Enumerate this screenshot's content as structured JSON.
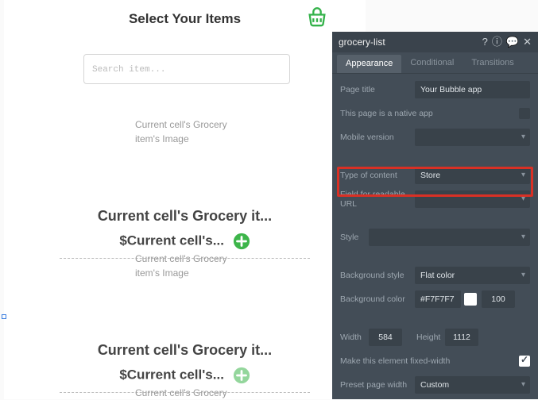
{
  "canvas": {
    "title": "Select Your Items",
    "search_placeholder": "Search item...",
    "cells": [
      {
        "img": "Current cell's Grocery item's Image",
        "title": "Current cell's Grocery it...",
        "price": "$Current cell's..."
      },
      {
        "img": "Current cell's Grocery item's Image",
        "title": "Current cell's Grocery it...",
        "price": "$Current cell's..."
      },
      {
        "img": "Current cell's Grocery"
      }
    ]
  },
  "panel": {
    "name": "grocery-list",
    "tabs": [
      "Appearance",
      "Conditional",
      "Transitions"
    ],
    "active_tab": 0,
    "fields": {
      "page_title_label": "Page title",
      "page_title_value": "Your Bubble app",
      "native_label": "This page is a native app",
      "native_value": false,
      "mobile_label": "Mobile version",
      "mobile_value": "",
      "type_label": "Type of content",
      "type_value": "Store",
      "readable_label": "Field for readable URL",
      "readable_value": "",
      "style_label": "Style",
      "style_value": "",
      "bgstyle_label": "Background style",
      "bgstyle_value": "Flat color",
      "bgcolor_label": "Background color",
      "bgcolor_value": "#F7F7F7",
      "bgcolor_alpha": "100",
      "width_label": "Width",
      "width_value": "584",
      "height_label": "Height",
      "height_value": "1112",
      "fixedw_label": "Make this element fixed-width",
      "fixedw_value": true,
      "preset_label": "Preset page width",
      "preset_value": "Custom"
    }
  }
}
